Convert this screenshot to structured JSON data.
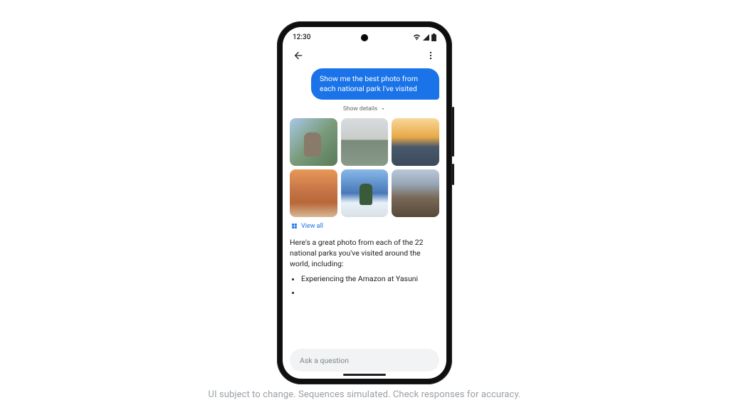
{
  "statusbar": {
    "time": "12:30"
  },
  "chat": {
    "user_message": "Show me the best photo from each national park I've visited",
    "show_details": "Show details",
    "view_all": "View all",
    "ai_text": "Here's a great photo from each of the 22 national parks you've visited around the world, including:",
    "ai_list": [
      "Experiencing the Amazon at Yasuni"
    ]
  },
  "input": {
    "placeholder": "Ask a question"
  },
  "footer": {
    "disclaimer": "UI subject to change. Sequences simulated. Check responses for accuracy."
  }
}
